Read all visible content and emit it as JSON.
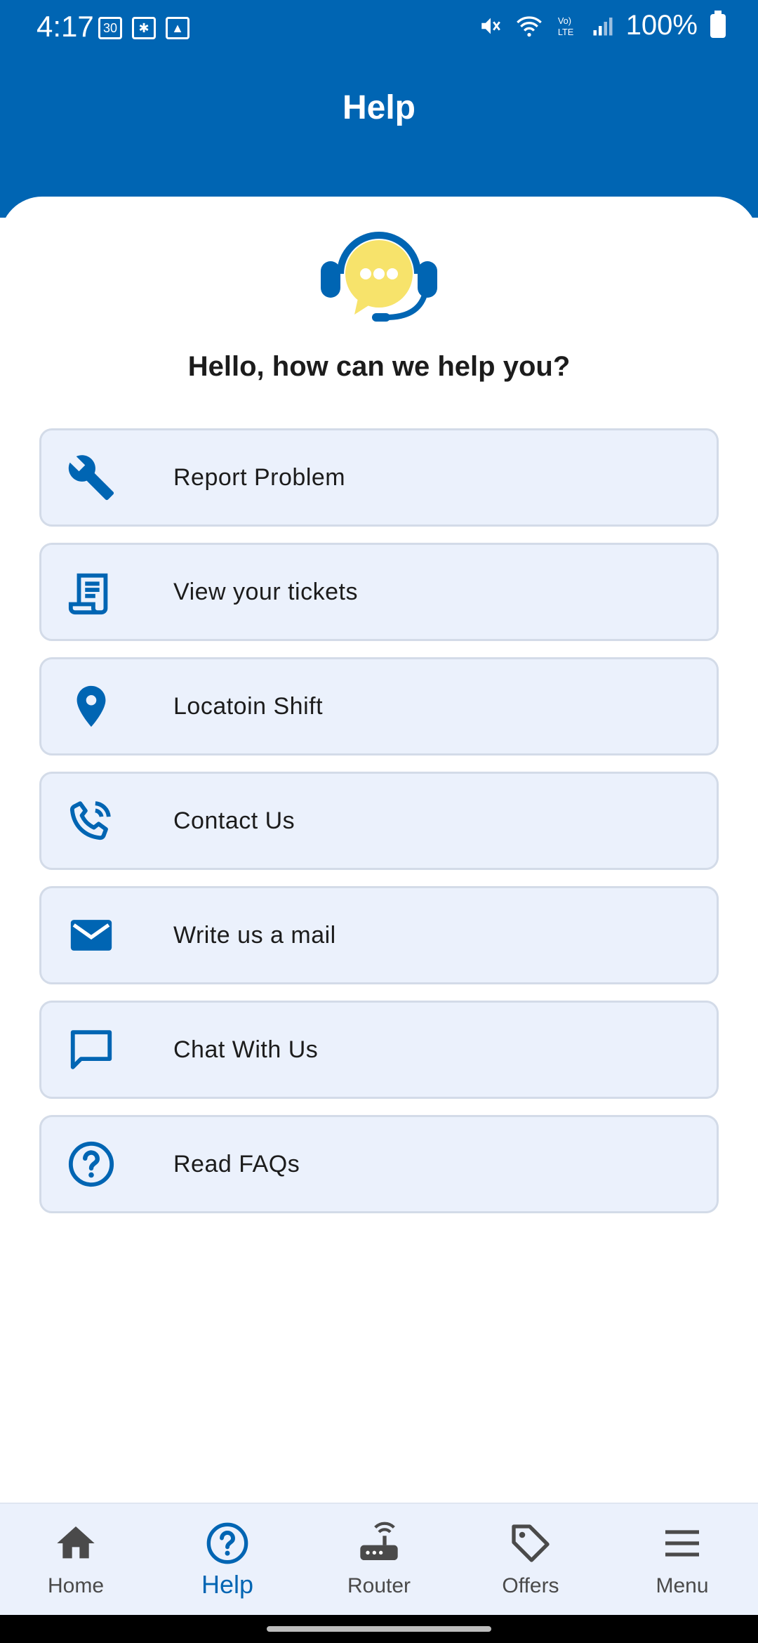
{
  "status_bar": {
    "time": "4:17",
    "battery": "100%"
  },
  "header": {
    "title": "Help"
  },
  "greeting": "Hello, how can we help you?",
  "menu": [
    {
      "label": "Report Problem",
      "icon": "wrench-icon"
    },
    {
      "label": "View your tickets",
      "icon": "ticket-icon"
    },
    {
      "label": "Locatoin Shift",
      "icon": "location-pin-icon"
    },
    {
      "label": "Contact Us",
      "icon": "phone-icon"
    },
    {
      "label": "Write us a mail",
      "icon": "mail-icon"
    },
    {
      "label": "Chat With Us",
      "icon": "chat-icon"
    },
    {
      "label": "Read FAQs",
      "icon": "help-circle-icon"
    }
  ],
  "bottom_nav": [
    {
      "label": "Home",
      "icon": "home-icon",
      "active": false
    },
    {
      "label": "Help",
      "icon": "help-circle-icon",
      "active": true
    },
    {
      "label": "Router",
      "icon": "router-icon",
      "active": false
    },
    {
      "label": "Offers",
      "icon": "tag-icon",
      "active": false
    },
    {
      "label": "Menu",
      "icon": "hamburger-menu-icon",
      "active": false
    }
  ],
  "colors": {
    "primary": "#0065b3",
    "card_bg": "#ebf1fc",
    "accent_yellow": "#f7e36b"
  }
}
